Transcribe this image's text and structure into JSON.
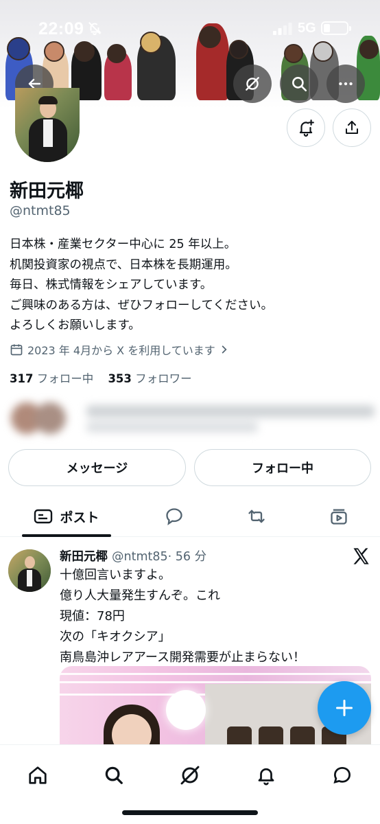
{
  "status_bar": {
    "time": "22:09",
    "network": "5G"
  },
  "header": {
    "back_icon": "arrow-left-icon",
    "grok_icon": "grok-icon",
    "search_icon": "search-icon",
    "more_icon": "more-horizontal-icon"
  },
  "profile": {
    "name": "新田元椰",
    "handle": "@ntmt85",
    "bio": [
      "日本株・産業セクター中心に 25 年以上。",
      "机関投資家の視点で、日本株を長期運用。",
      "毎日、株式情報をシェアしています。",
      "ご興味のある方は、ぜひフォローしてください。",
      "よろしくお願いします。"
    ],
    "joined": "2023 年 4月から X を利用しています",
    "following_count": "317",
    "following_label": "フォロー中",
    "followers_count": "353",
    "followers_label": "フォロワー"
  },
  "actions": {
    "message_label": "メッセージ",
    "following_button_label": "フォロー中"
  },
  "tabs": [
    {
      "label": "ポスト",
      "icon": "posts-icon",
      "active": true
    },
    {
      "label": "",
      "icon": "replies-icon",
      "active": false
    },
    {
      "label": "",
      "icon": "reposts-icon",
      "active": false
    },
    {
      "label": "",
      "icon": "media-icon",
      "active": false
    }
  ],
  "post": {
    "author_name": "新田元椰",
    "author_handle": "@ntmt85",
    "time": "· 56 分",
    "lines": [
      "十億回言いますよ。",
      "億り人大量発生すんぞ。これ",
      "現値：78円",
      "次の「キオクシア」",
      "南鳥島沖レアアース開発需要が止まらない！"
    ]
  },
  "colors": {
    "accent": "#1d9bf0",
    "text_primary": "#0f1419",
    "text_secondary": "#536471",
    "border": "#cfd9de"
  },
  "bottom_nav": [
    "home-icon",
    "search-icon",
    "grok-icon",
    "notifications-icon",
    "messages-icon"
  ]
}
